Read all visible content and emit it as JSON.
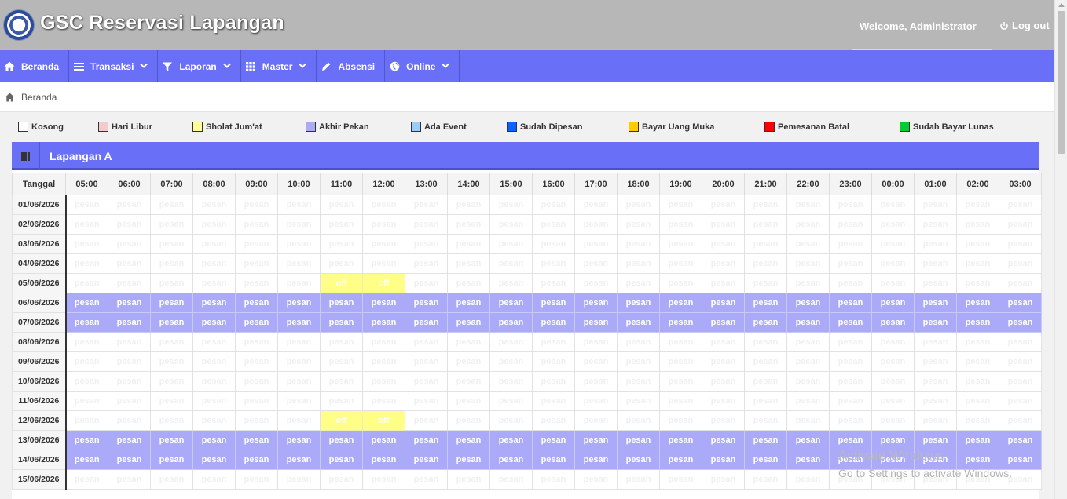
{
  "header": {
    "app_title": "GSC Reservasi Lapangan",
    "welcome": "Welcome, Administrator",
    "logout": "Log out"
  },
  "nav": [
    {
      "label": "Beranda",
      "icon": "home-icon",
      "dropdown": false
    },
    {
      "label": "Transaksi",
      "icon": "list-icon",
      "dropdown": true
    },
    {
      "label": "Laporan",
      "icon": "filter-icon",
      "dropdown": true
    },
    {
      "label": "Master",
      "icon": "grid-icon",
      "dropdown": true
    },
    {
      "label": "Absensi",
      "icon": "pencil-icon",
      "dropdown": false
    },
    {
      "label": "Online",
      "icon": "globe-icon",
      "dropdown": true
    }
  ],
  "breadcrumb": {
    "label": "Beranda"
  },
  "legend": [
    {
      "label": "Kosong",
      "color": "#ffffff"
    },
    {
      "label": "Hari Libur",
      "color": "#f2cccc"
    },
    {
      "label": "Sholat Jum'at",
      "color": "#ffff99"
    },
    {
      "label": "Akhir Pekan",
      "color": "#aaaaf8"
    },
    {
      "label": "Ada Event",
      "color": "#99ccff"
    },
    {
      "label": "Sudah Dipesan",
      "color": "#0066ff"
    },
    {
      "label": "Bayar Uang Muka",
      "color": "#ffcc00"
    },
    {
      "label": "Pemesanan Batal",
      "color": "#ff0000"
    },
    {
      "label": "Sudah Bayar Lunas",
      "color": "#00cc33"
    }
  ],
  "panel": {
    "title": "Lapangan A",
    "date_header": "Tanggal",
    "hours": [
      "05:00",
      "06:00",
      "07:00",
      "08:00",
      "09:00",
      "10:00",
      "11:00",
      "12:00",
      "13:00",
      "14:00",
      "15:00",
      "16:00",
      "17:00",
      "18:00",
      "19:00",
      "20:00",
      "21:00",
      "22:00",
      "23:00",
      "00:00",
      "01:00",
      "02:00",
      "03:00"
    ],
    "cell_label_book": "pesan",
    "cell_label_off": "off",
    "rows": [
      {
        "date": "01/06/2026",
        "status": "kosong",
        "off_hours": []
      },
      {
        "date": "02/06/2026",
        "status": "kosong",
        "off_hours": []
      },
      {
        "date": "03/06/2026",
        "status": "kosong",
        "off_hours": []
      },
      {
        "date": "04/06/2026",
        "status": "kosong",
        "off_hours": []
      },
      {
        "date": "05/06/2026",
        "status": "kosong",
        "off_hours": [
          "11:00",
          "12:00"
        ]
      },
      {
        "date": "06/06/2026",
        "status": "akhir-pekan",
        "off_hours": []
      },
      {
        "date": "07/06/2026",
        "status": "akhir-pekan",
        "off_hours": []
      },
      {
        "date": "08/06/2026",
        "status": "kosong",
        "off_hours": []
      },
      {
        "date": "09/06/2026",
        "status": "kosong",
        "off_hours": []
      },
      {
        "date": "10/06/2026",
        "status": "kosong",
        "off_hours": []
      },
      {
        "date": "11/06/2026",
        "status": "kosong",
        "off_hours": []
      },
      {
        "date": "12/06/2026",
        "status": "kosong",
        "off_hours": [
          "11:00",
          "12:00"
        ]
      },
      {
        "date": "13/06/2026",
        "status": "akhir-pekan",
        "off_hours": []
      },
      {
        "date": "14/06/2026",
        "status": "akhir-pekan",
        "off_hours": []
      },
      {
        "date": "15/06/2026",
        "status": "kosong",
        "off_hours": []
      }
    ]
  },
  "watermark": {
    "line1": "Activate Windows",
    "line2": "Go to Settings to activate Windows."
  }
}
